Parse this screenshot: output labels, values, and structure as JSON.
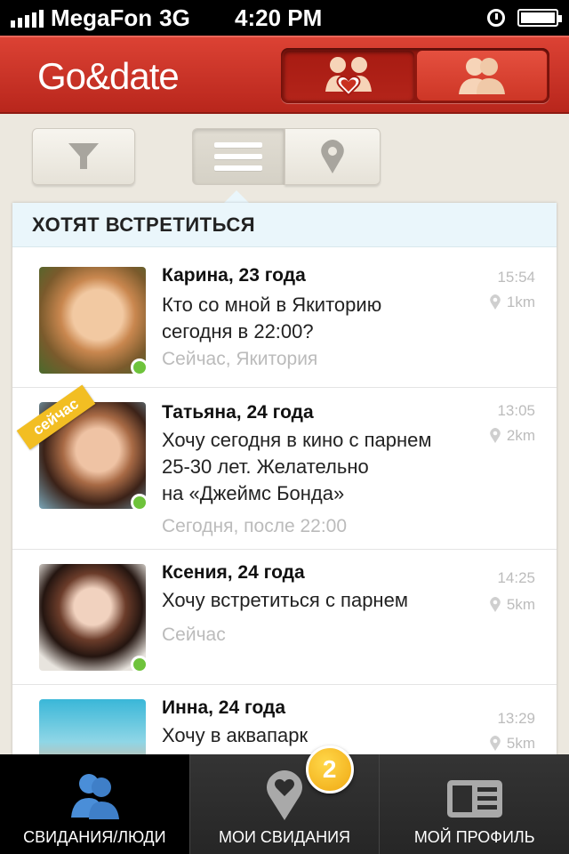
{
  "status_bar": {
    "carrier": "MegaFon",
    "network": "3G",
    "time": "4:20 PM"
  },
  "header": {
    "logo": "Go&date",
    "mode_left_icon": "couple-heart-icon",
    "mode_right_icon": "people-icon",
    "accent": "#c9301f"
  },
  "toolbar": {
    "filter_icon": "filter-icon",
    "list_icon": "list-icon",
    "map_icon": "map-pin-icon"
  },
  "section": {
    "title": "ХОТЯТ ВСТРЕТИТЬСЯ"
  },
  "rows": [
    {
      "name": "Карина, 23 года",
      "message_lines": [
        "Кто со мной в Якиторию",
        "сегодня в  22:00?"
      ],
      "when": "Сейчас, Якитория",
      "time": "15:54",
      "distance": "1km",
      "online": true,
      "now_badge": ""
    },
    {
      "name": "Татьяна, 24 года",
      "message_lines": [
        "Хочу сегодня в кино с парнем",
        "25-30 лет. Желательно",
        "на «Джеймс Бонда»"
      ],
      "when": "Сегодня, после 22:00",
      "time": "13:05",
      "distance": "2km",
      "online": true,
      "now_badge": "сейчас"
    },
    {
      "name": "Ксения, 24 года",
      "message_lines": [
        "Хочу встретиться с парнем"
      ],
      "when": "Сейчас",
      "time": "14:25",
      "distance": "5km",
      "online": true,
      "now_badge": ""
    },
    {
      "name": "Инна, 24 года",
      "message_lines": [
        "Хочу в аквапарк"
      ],
      "when": "",
      "time": "13:29",
      "distance": "5km",
      "online": false,
      "now_badge": ""
    }
  ],
  "tabs": [
    {
      "label": "СВИДАНИЯ/ЛЮДИ",
      "icon": "people-icon",
      "active": true
    },
    {
      "label": "МОИ СВИДАНИЯ",
      "icon": "heart-pin-icon",
      "badge": "2"
    },
    {
      "label": "МОЙ ПРОФИЛЬ",
      "icon": "profile-card-icon"
    }
  ]
}
